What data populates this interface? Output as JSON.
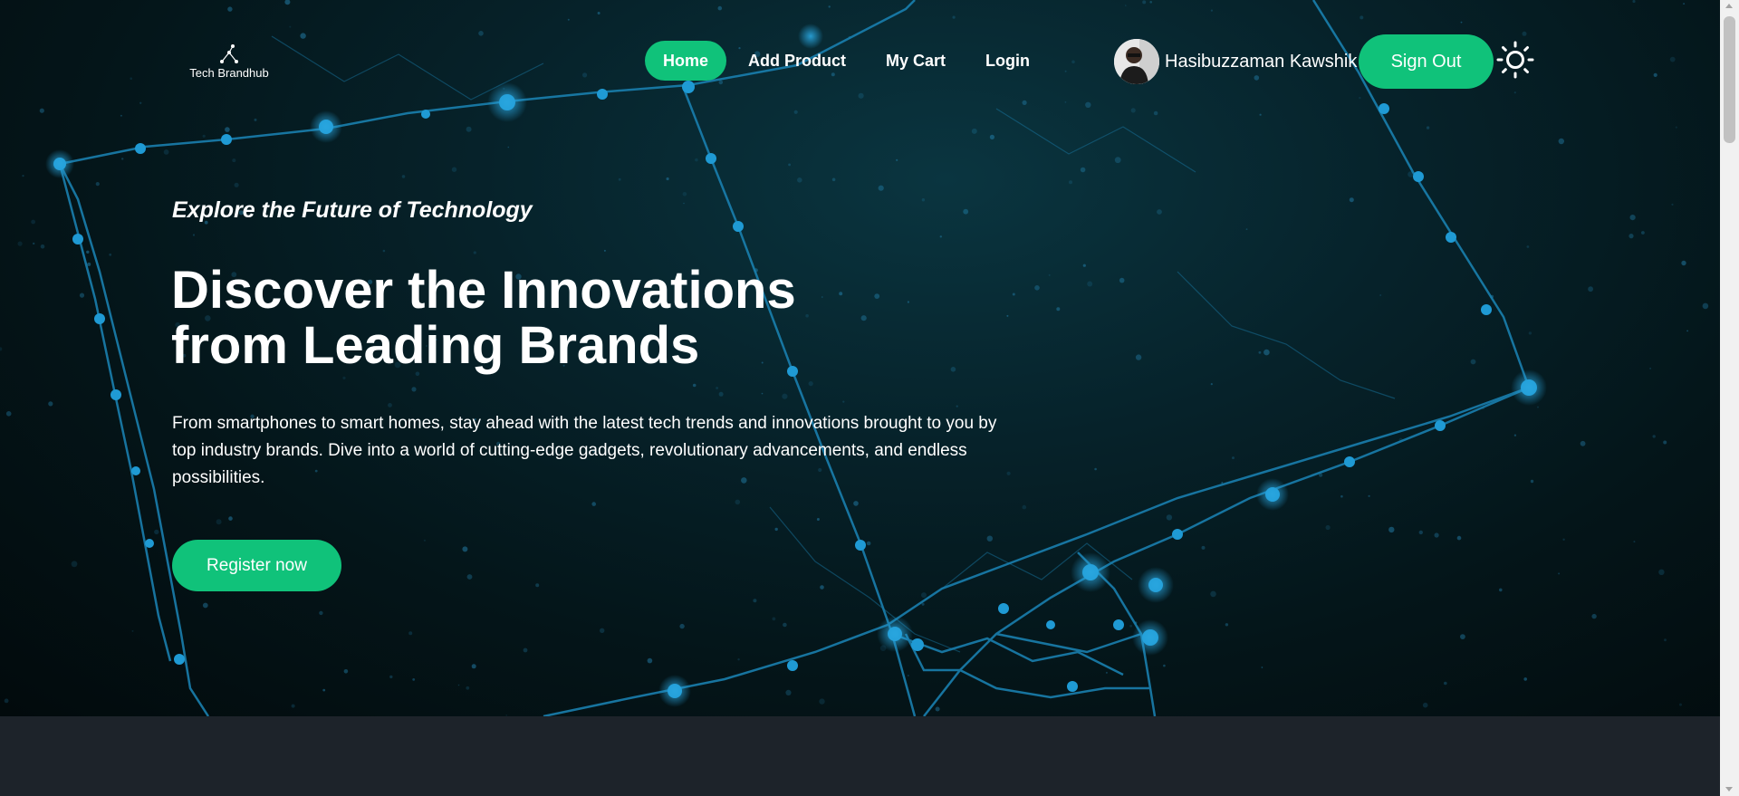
{
  "brand": {
    "name": "Tech Brandhub",
    "logo_icon": "network-nodes-icon"
  },
  "nav": {
    "links": [
      {
        "label": "Home",
        "active": true
      },
      {
        "label": "Add Product",
        "active": false
      },
      {
        "label": "My Cart",
        "active": false
      },
      {
        "label": "Login",
        "active": false
      }
    ]
  },
  "user": {
    "name": "Hasibuzzaman Kawshik",
    "avatar_icon": "user-avatar",
    "sign_out_label": "Sign Out",
    "theme_icon": "sun-icon"
  },
  "hero": {
    "eyebrow": "Explore the Future of Technology",
    "headline_line1": "Discover the Innovations",
    "headline_line2": "from Leading Brands",
    "description": "From smartphones to smart homes, stay ahead with the latest tech trends and innovations brought to you by top industry brands. Dive into a world of cutting-edge gadgets, revolutionary advancements, and endless possibilities.",
    "cta_label": "Register now"
  },
  "colors": {
    "accent": "#10c27a",
    "hero_bg": "#041519",
    "network_line": "#1a7fae",
    "page_bg": "#1d232a"
  }
}
